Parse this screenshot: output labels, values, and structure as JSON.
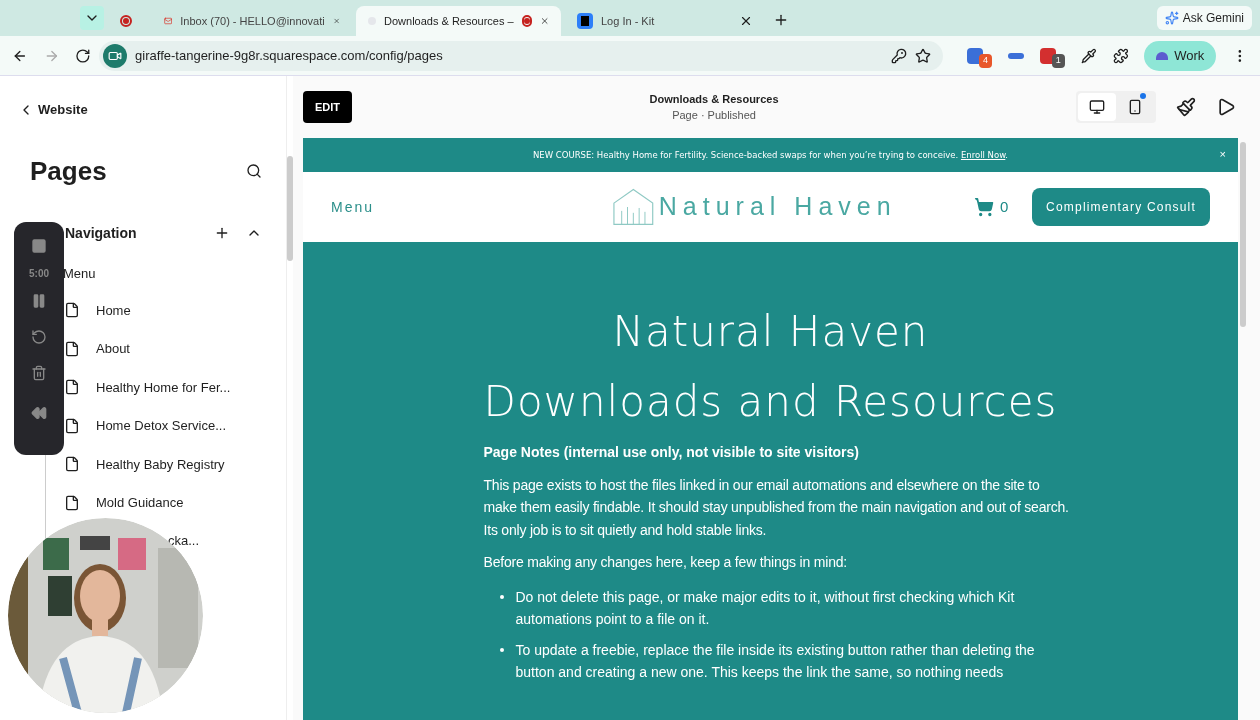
{
  "browser": {
    "tabs": [
      {
        "kind": "recording",
        "selected": false,
        "recording": true
      },
      {
        "kind": "mail",
        "title": "Inbox (70) - HELLO@innovati",
        "selected": false,
        "recording": false
      },
      {
        "kind": "page",
        "title": "Downloads & Resources –",
        "selected": true,
        "recording": true
      },
      {
        "kind": "kit",
        "title": "Log In - Kit",
        "selected": false,
        "recording": false
      }
    ],
    "gemini": "Ask Gemini",
    "url": "giraffe-tangerine-9g8r.squarespace.com/config/pages",
    "extension_badges": [
      "4",
      "1"
    ],
    "profile": "Work"
  },
  "sidebar": {
    "back": "Website",
    "title": "Pages",
    "section": "Navigation",
    "menu_label": "Menu",
    "pages": [
      "Home",
      "About",
      "Healthy Home for Fer...",
      "Home Detox Service...",
      "Healthy Baby Registry",
      "Mold Guidance"
    ],
    "partial_item": "cka..."
  },
  "recorder": {
    "time": "5:00"
  },
  "preview": {
    "edit": "EDIT",
    "title": "Downloads & Resources",
    "subtitle": "Page · Published",
    "devices": [
      {
        "kind": "desktop",
        "selected": true
      },
      {
        "kind": "mobile",
        "selected": false
      }
    ],
    "banner": {
      "text": "NEW COURSE: Healthy Home for Fertility. Science-backed swaps for when you’re trying to conceive. ",
      "link": "Enroll Now",
      "end": ".",
      "close": "×"
    },
    "header": {
      "menu": "Menu",
      "logo": "Natural Haven",
      "cart": "0",
      "cta": "Complimentary Consult"
    },
    "hero": {
      "title": [
        "Natural Haven",
        "Downloads and Resources"
      ],
      "notes_heading": "Page Notes (internal use only, not visible to site visitors)",
      "paragraphs": [
        "This page exists to host the files linked in our email automations and elsewhere on the site to make them easily findable. It should stay unpublished from the main navigation and out of search. Its only job is to sit quietly and hold stable links.",
        "Before making any changes here, keep a few things in mind:"
      ],
      "bullets": [
        "Do not delete this page, or make major edits to it, without first checking which Kit automations point to a file on it.",
        "To update a freebie, replace the file inside its existing button rather than deleting the button and creating a new one. This keeps the link the same, so nothing needs"
      ]
    }
  }
}
